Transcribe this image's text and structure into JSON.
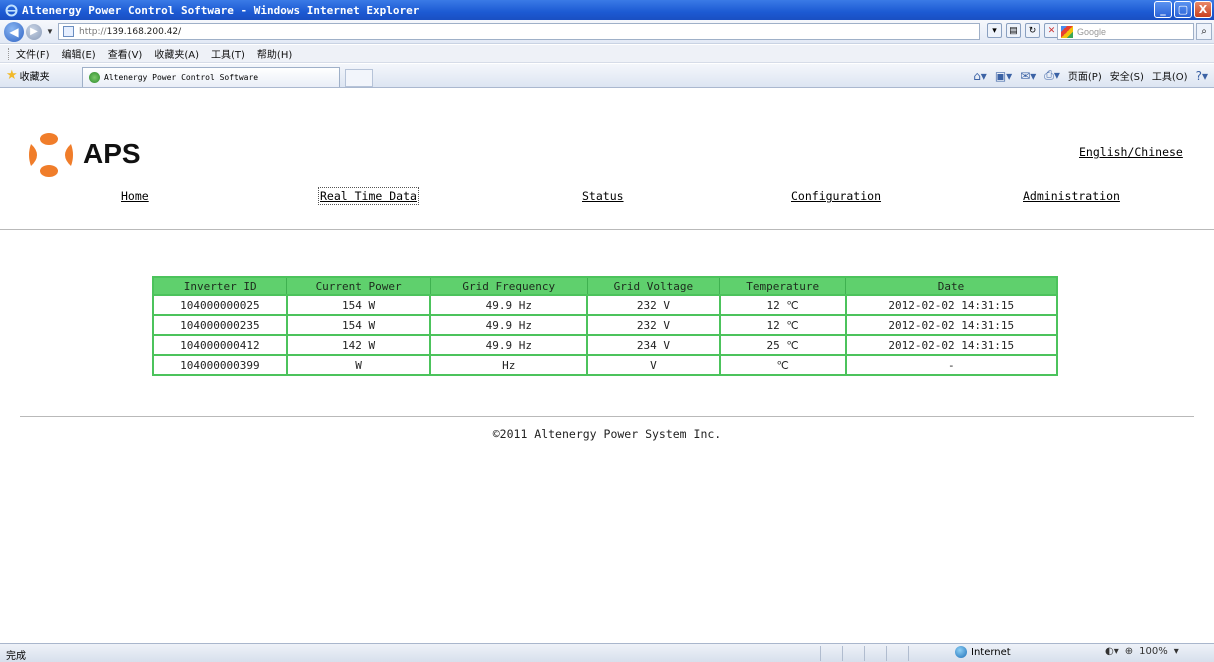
{
  "window": {
    "title": "Altenergy Power Control Software - Windows Internet Explorer",
    "btn_min": "_",
    "btn_max": "▢",
    "btn_close": "X"
  },
  "address": {
    "url_scheme": "http://",
    "url_host": "139.168.200.42/",
    "search_placeholder": "Google"
  },
  "menu": {
    "items": [
      "文件(F)",
      "编辑(E)",
      "查看(V)",
      "收藏夹(A)",
      "工具(T)",
      "帮助(H)"
    ]
  },
  "favorites": {
    "label": "收藏夹",
    "tab_title": "Altenergy Power Control Software",
    "cmd_page": "页面(P)",
    "cmd_safety": "安全(S)",
    "cmd_tools": "工具(O)"
  },
  "brand": {
    "name": "APS",
    "logo_color": "#f07d2a"
  },
  "header": {
    "language_link": "English/Chinese"
  },
  "nav": {
    "home": "Home",
    "realtime": "Real Time Data",
    "status": "Status",
    "configuration": "Configuration",
    "administration": "Administration"
  },
  "table": {
    "columns": [
      "Inverter ID",
      "Current Power",
      "Grid Frequency",
      "Grid Voltage",
      "Temperature",
      "Date"
    ],
    "rows": [
      [
        "104000000025",
        "154 W",
        "49.9 Hz",
        "232 V",
        "12 ℃",
        "2012-02-02 14:31:15"
      ],
      [
        "104000000235",
        "154 W",
        "49.9 Hz",
        "232 V",
        "12 ℃",
        "2012-02-02 14:31:15"
      ],
      [
        "104000000412",
        "142 W",
        "49.9 Hz",
        "234 V",
        "25 ℃",
        "2012-02-02 14:31:15"
      ],
      [
        "104000000399",
        "W",
        "Hz",
        "V",
        "℃",
        "-"
      ]
    ],
    "header_color": "#5fd06d",
    "border_color": "#4cc35c"
  },
  "footer": {
    "copyright": "©2011 Altenergy Power System Inc."
  },
  "statusbar": {
    "status": "完成",
    "zone": "Internet",
    "zoom": "100%"
  }
}
